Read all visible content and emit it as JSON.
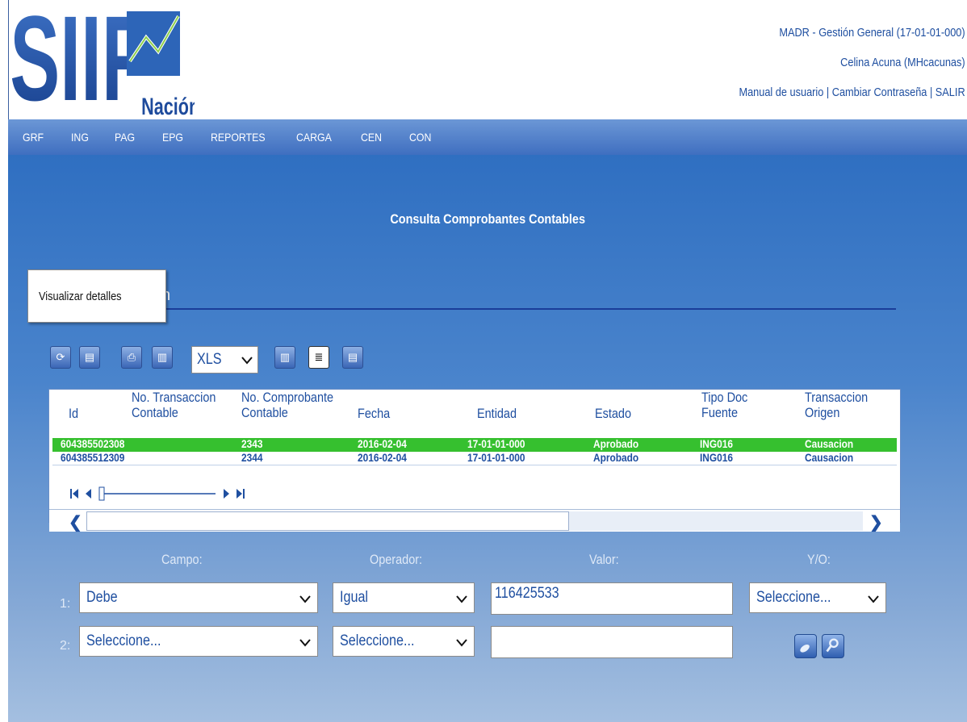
{
  "header": {
    "logo_text_main": "SIIF",
    "logo_text_sub": "Nación",
    "context": "MADR - Gestión General (17-01-01-000)",
    "user": "Celina Acuna (MHcacunas)",
    "links": [
      "Manual de usuario",
      "Cambiar Contraseña",
      "SALIR"
    ],
    "separator": " | "
  },
  "nav": {
    "items": [
      "GRF",
      "ING",
      "PAG",
      "EPG",
      "REPORTES",
      "CARGA",
      "CEN",
      "CON"
    ]
  },
  "page": {
    "title": "Consulta Comprobantes Contables",
    "section_tail": "n",
    "tooltip": "Visualizar detalles"
  },
  "toolbar": {
    "icons": [
      "refresh-icon",
      "view-details-icon",
      "print-icon",
      "save-icon",
      "export-icon",
      "notes-icon",
      "search-details-icon"
    ],
    "export_format": "XLS"
  },
  "grid": {
    "columns": [
      [
        "Id"
      ],
      [
        "No. Transaccion",
        "Contable"
      ],
      [
        "No. Comprobante",
        "Contable"
      ],
      [
        "Fecha"
      ],
      [
        "Entidad"
      ],
      [
        "Estado"
      ],
      [
        "Tipo Doc",
        "Fuente"
      ],
      [
        "Transaccion",
        "Origen"
      ]
    ],
    "rows": [
      [
        "604385502308",
        "2343",
        "2016-02-04",
        "17-01-01-000",
        "Aprobado",
        "ING016",
        "Causacion"
      ],
      [
        "604385512309",
        "2344",
        "2016-02-04",
        "17-01-01-000",
        "Aprobado",
        "ING016",
        "Causacion"
      ]
    ],
    "selected_row": 0
  },
  "filter": {
    "labels": {
      "campo": "Campo:",
      "operador": "Operador:",
      "valor": "Valor:",
      "yo": "Y/O:"
    },
    "rows": [
      {
        "num": "1:",
        "campo": "Debe",
        "operador": "Igual",
        "valor": "116425533",
        "yo": "Seleccione..."
      },
      {
        "num": "2:",
        "campo": "Seleccione...",
        "operador": "Seleccione...",
        "valor": ""
      }
    ]
  },
  "colors": {
    "nav": "#3f6fc0",
    "selected_row": "#36c02f",
    "text_blue": "#1f4fa0"
  }
}
